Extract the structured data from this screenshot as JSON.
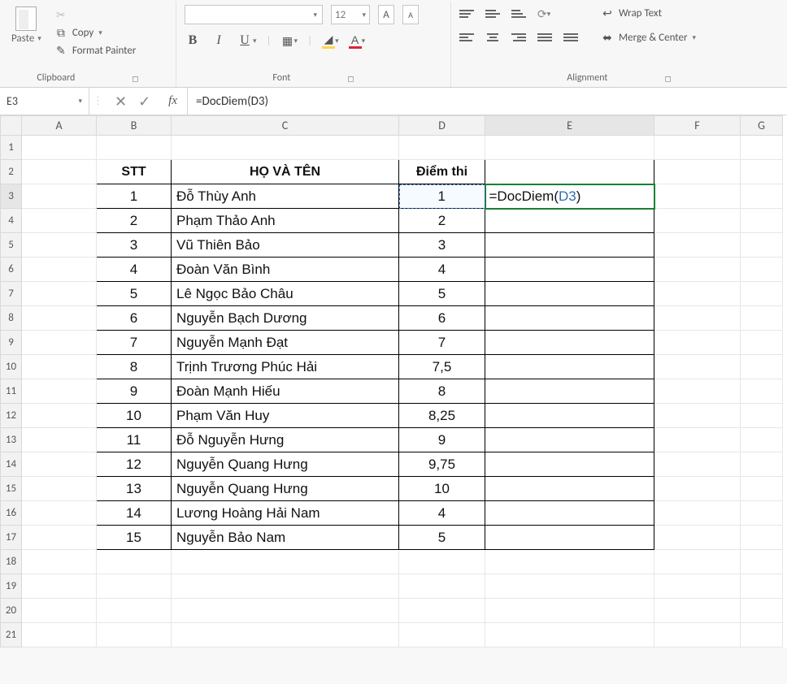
{
  "ribbon": {
    "clipboard": {
      "paste_label": "Paste",
      "copy_label": "Copy",
      "format_painter_label": "Format Painter",
      "group_label": "Clipboard"
    },
    "font": {
      "group_label": "Font",
      "font_name": "",
      "font_size": "12",
      "bold": "B",
      "italic": "I",
      "underline": "U"
    },
    "alignment": {
      "group_label": "Alignment",
      "wrap_text": "Wrap Text",
      "merge_center": "Merge & Center"
    }
  },
  "formula_bar": {
    "cell_ref": "E3",
    "formula_text": "=DocDiem(D3)",
    "fx_label": "fx"
  },
  "columns": [
    "A",
    "B",
    "C",
    "D",
    "E",
    "F",
    "G"
  ],
  "rows_visible": [
    "1",
    "2",
    "3",
    "4",
    "5",
    "6",
    "7",
    "8",
    "9",
    "10",
    "11",
    "12",
    "13",
    "14",
    "15",
    "16",
    "17",
    "18",
    "19",
    "20",
    "21"
  ],
  "table": {
    "headers": {
      "stt": "STT",
      "name": "HỌ VÀ TÊN",
      "score": "Điểm thi"
    },
    "rows": [
      {
        "stt": "1",
        "name": "Đỗ Thùy Anh",
        "score": "1"
      },
      {
        "stt": "2",
        "name": "Phạm Thảo Anh",
        "score": "2"
      },
      {
        "stt": "3",
        "name": "Vũ Thiên Bảo",
        "score": "3"
      },
      {
        "stt": "4",
        "name": "Đoàn Văn Bình",
        "score": "4"
      },
      {
        "stt": "5",
        "name": "Lê Ngọc Bảo Châu",
        "score": "5"
      },
      {
        "stt": "6",
        "name": "Nguyễn Bạch Dương",
        "score": "6"
      },
      {
        "stt": "7",
        "name": "Nguyễn Mạnh Đạt",
        "score": "7"
      },
      {
        "stt": "8",
        "name": "Trịnh Trương Phúc Hải",
        "score": "7,5"
      },
      {
        "stt": "9",
        "name": "Đoàn Mạnh Hiếu",
        "score": "8"
      },
      {
        "stt": "10",
        "name": "Phạm Văn Huy",
        "score": "8,25"
      },
      {
        "stt": "11",
        "name": "Đỗ Nguyễn Hưng",
        "score": "9"
      },
      {
        "stt": "12",
        "name": "Nguyễn Quang Hưng",
        "score": "9,75"
      },
      {
        "stt": "13",
        "name": "Nguyễn Quang Hưng",
        "score": "10"
      },
      {
        "stt": "14",
        "name": "Lương Hoàng Hải Nam",
        "score": "4"
      },
      {
        "stt": "15",
        "name": "Nguyễn Bảo Nam",
        "score": "5"
      }
    ]
  },
  "active_cell": {
    "prefix": "=DocDiem(",
    "ref": "D3",
    "suffix": ")"
  }
}
